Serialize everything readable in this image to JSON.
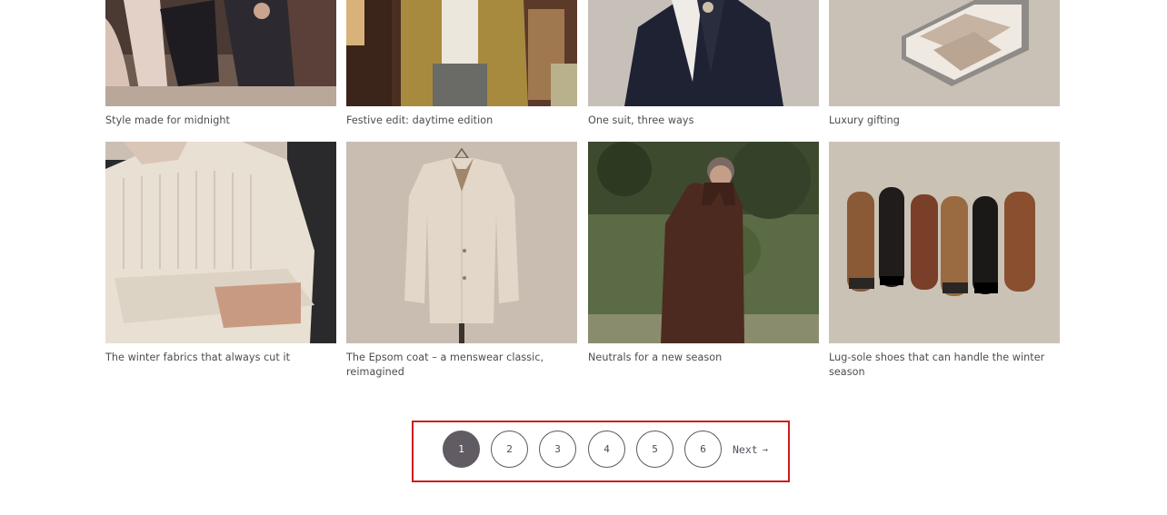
{
  "articles_row1": [
    {
      "title": "Style made for midnight",
      "image": "dancing-couples-photo"
    },
    {
      "title": "Festive edit: daytime edition",
      "image": "mustard-cardigan-photo"
    },
    {
      "title": "One suit, three ways",
      "image": "navy-suit-photo"
    },
    {
      "title": "Luxury gifting",
      "image": "gift-box-knitwear-photo"
    }
  ],
  "articles_row2": [
    {
      "title": "The winter fabrics that always cut it",
      "image": "cream-knit-sweater-photo"
    },
    {
      "title": "The Epsom coat – a menswear classic, reimagined",
      "image": "beige-overcoat-photo"
    },
    {
      "title": "Neutrals for a new season",
      "image": "brown-coat-outdoor-photo"
    },
    {
      "title": "Lug-sole shoes that can handle the winter season",
      "image": "lug-sole-shoes-photo"
    }
  ],
  "pagination": {
    "pages": [
      "1",
      "2",
      "3",
      "4",
      "5",
      "6"
    ],
    "current": "1",
    "next_label": "Next",
    "next_icon": "arrow-right-icon"
  },
  "colors": {
    "active_page": "#615b63",
    "highlight_border": "#cc1d1d",
    "text": "#4c4c4c"
  }
}
